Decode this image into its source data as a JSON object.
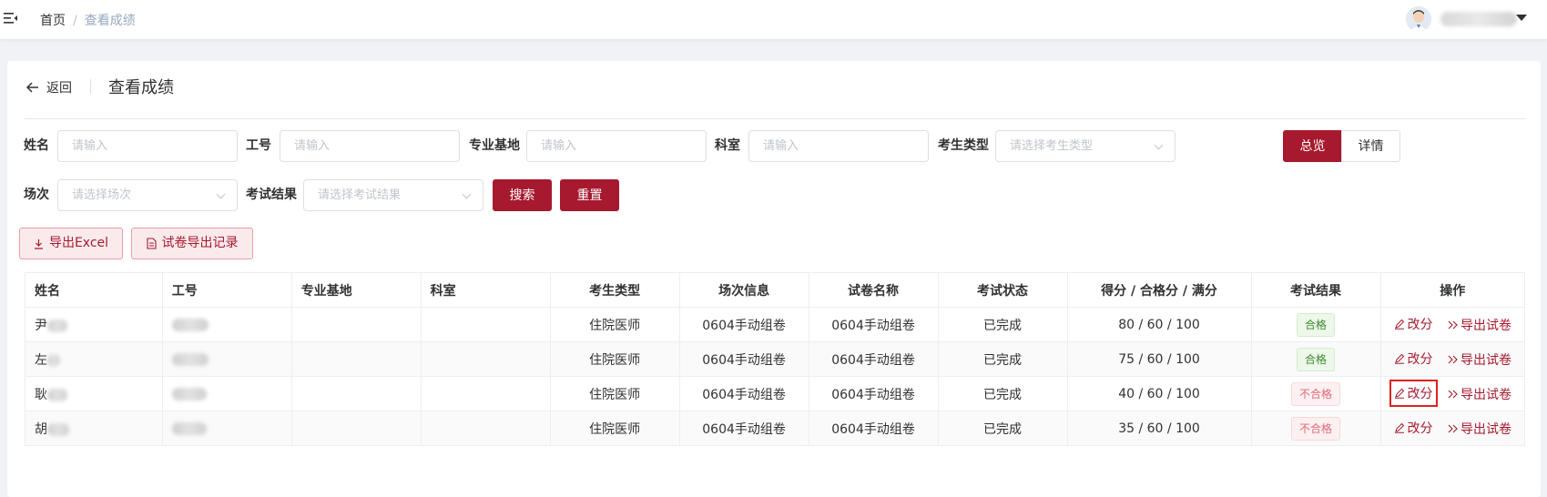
{
  "breadcrumb": {
    "home": "首页",
    "separator": "/",
    "current": "查看成绩"
  },
  "header": {
    "back_label": "返回",
    "title": "查看成绩"
  },
  "filters": {
    "name": {
      "label": "姓名",
      "placeholder": "请输入"
    },
    "staff_id": {
      "label": "工号",
      "placeholder": "请输入"
    },
    "base": {
      "label": "专业基地",
      "placeholder": "请输入"
    },
    "dept": {
      "label": "科室",
      "placeholder": "请输入"
    },
    "type": {
      "label": "考生类型",
      "placeholder": "请选择考生类型"
    },
    "session": {
      "label": "场次",
      "placeholder": "请选择场次"
    },
    "result": {
      "label": "考试结果",
      "placeholder": "请选择考试结果"
    },
    "search_label": "搜索",
    "reset_label": "重置"
  },
  "view_toggle": {
    "overview": "总览",
    "detail": "详情"
  },
  "actions": {
    "export_excel": "导出Excel",
    "export_records": "试卷导出记录"
  },
  "table": {
    "columns": [
      "姓名",
      "工号",
      "专业基地",
      "科室",
      "考生类型",
      "场次信息",
      "试卷名称",
      "考试状态",
      "得分 / 合格分 / 满分",
      "考试结果",
      "操作"
    ],
    "rows": [
      {
        "name": "尹",
        "type": "住院医师",
        "session": "0604手动组卷",
        "paper": "0604手动组卷",
        "status": "已完成",
        "score": "80 / 60 / 100",
        "result": "合格"
      },
      {
        "name": "左",
        "type": "住院医师",
        "session": "0604手动组卷",
        "paper": "0604手动组卷",
        "status": "已完成",
        "score": "75 / 60 / 100",
        "result": "合格"
      },
      {
        "name": "耿",
        "type": "住院医师",
        "session": "0604手动组卷",
        "paper": "0604手动组卷",
        "status": "已完成",
        "score": "40 / 60 / 100",
        "result": "不合格"
      },
      {
        "name": "胡",
        "type": "住院医师",
        "session": "0604手动组卷",
        "paper": "0604手动组卷",
        "status": "已完成",
        "score": "35 / 60 / 100",
        "result": "不合格"
      }
    ],
    "op_edit": "改分",
    "op_export": "导出试卷"
  },
  "colors": {
    "primary": "#a6192e",
    "pass": "#3f8a2f",
    "fail": "#e06a78",
    "highlight": "#e02020"
  }
}
